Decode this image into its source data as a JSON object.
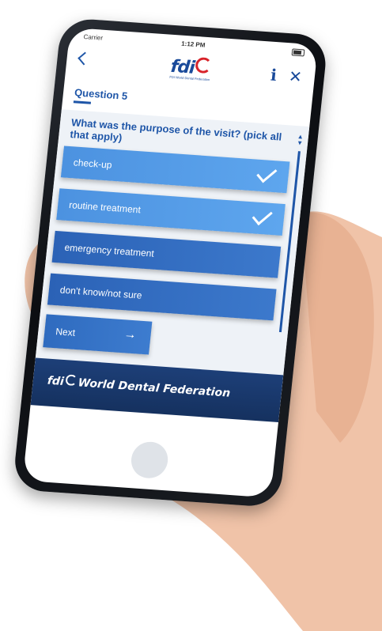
{
  "status_bar": {
    "carrier": "Carrier",
    "time": "1:12 PM"
  },
  "nav": {
    "logo_text": "fdi",
    "logo_subtext": "FDI World Dental Federation"
  },
  "question": {
    "label": "Question 5",
    "text": "What was the purpose of the visit? (pick all that apply)"
  },
  "options": [
    {
      "label": "check-up",
      "selected": true
    },
    {
      "label": "routine treatment",
      "selected": true
    },
    {
      "label": "emergency treatment",
      "selected": false
    },
    {
      "label": "don't know/not sure",
      "selected": false
    }
  ],
  "next_button": {
    "label": "Next"
  },
  "footer": {
    "brand": "fdi",
    "name": "World Dental Federation"
  },
  "colors": {
    "accent": "#1f56a8",
    "footer": "#1d3f78",
    "logo_red": "#d8232a"
  },
  "icons": [
    "back-icon",
    "info-icon",
    "close-icon",
    "check-icon",
    "arrow-right-icon",
    "scroll-arrows-icon"
  ]
}
